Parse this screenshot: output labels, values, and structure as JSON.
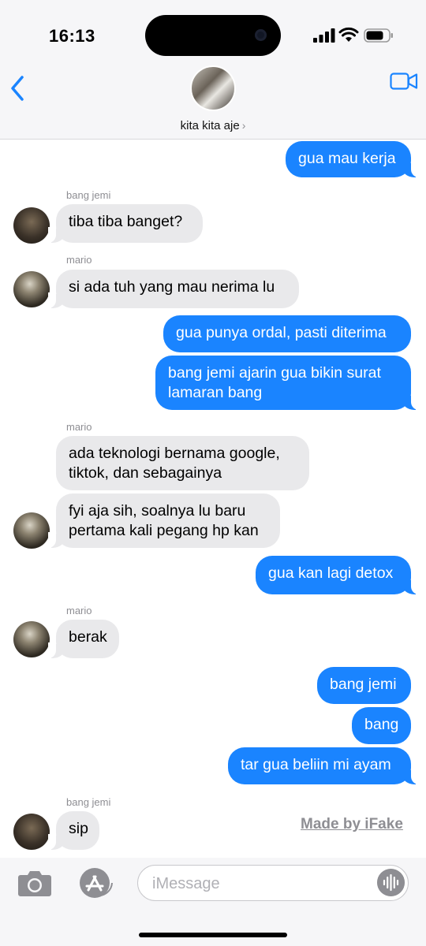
{
  "status_bar": {
    "time": "16:13"
  },
  "header": {
    "chat_name": "kita kita aje",
    "chevron": "›"
  },
  "messages": [
    {
      "text": "gua mau kerja"
    },
    {
      "sender": "bang jemi",
      "text": "tiba tiba banget?"
    },
    {
      "sender": "mario",
      "text": "si ada tuh yang mau nerima lu"
    },
    {
      "text": "gua punya ordal, pasti diterima"
    },
    {
      "text": "bang jemi ajarin gua bikin surat\nlamaran bang"
    },
    {
      "sender": "mario",
      "text": "ada teknologi bernama google,\ntiktok, dan sebagainya"
    },
    {
      "text": "fyi aja sih, soalnya lu baru\npertama kali pegang hp kan"
    },
    {
      "text": "gua kan lagi detox"
    },
    {
      "sender": "mario",
      "text": "berak"
    },
    {
      "text": "bang jemi"
    },
    {
      "text": "bang"
    },
    {
      "text": "tar gua beliin mi ayam"
    },
    {
      "sender": "bang jemi",
      "text": "sip"
    }
  ],
  "watermark": "Made by iFake",
  "input": {
    "placeholder": "iMessage"
  },
  "colors": {
    "outgoing": "#1a84ff",
    "incoming": "#e9e9eb",
    "accent": "#1a84ff"
  },
  "icons": [
    "back-chevron-icon",
    "facetime-video-icon",
    "camera-icon",
    "app-store-icon",
    "audio-waveform-icon",
    "signal-icon",
    "wifi-icon",
    "battery-icon"
  ]
}
